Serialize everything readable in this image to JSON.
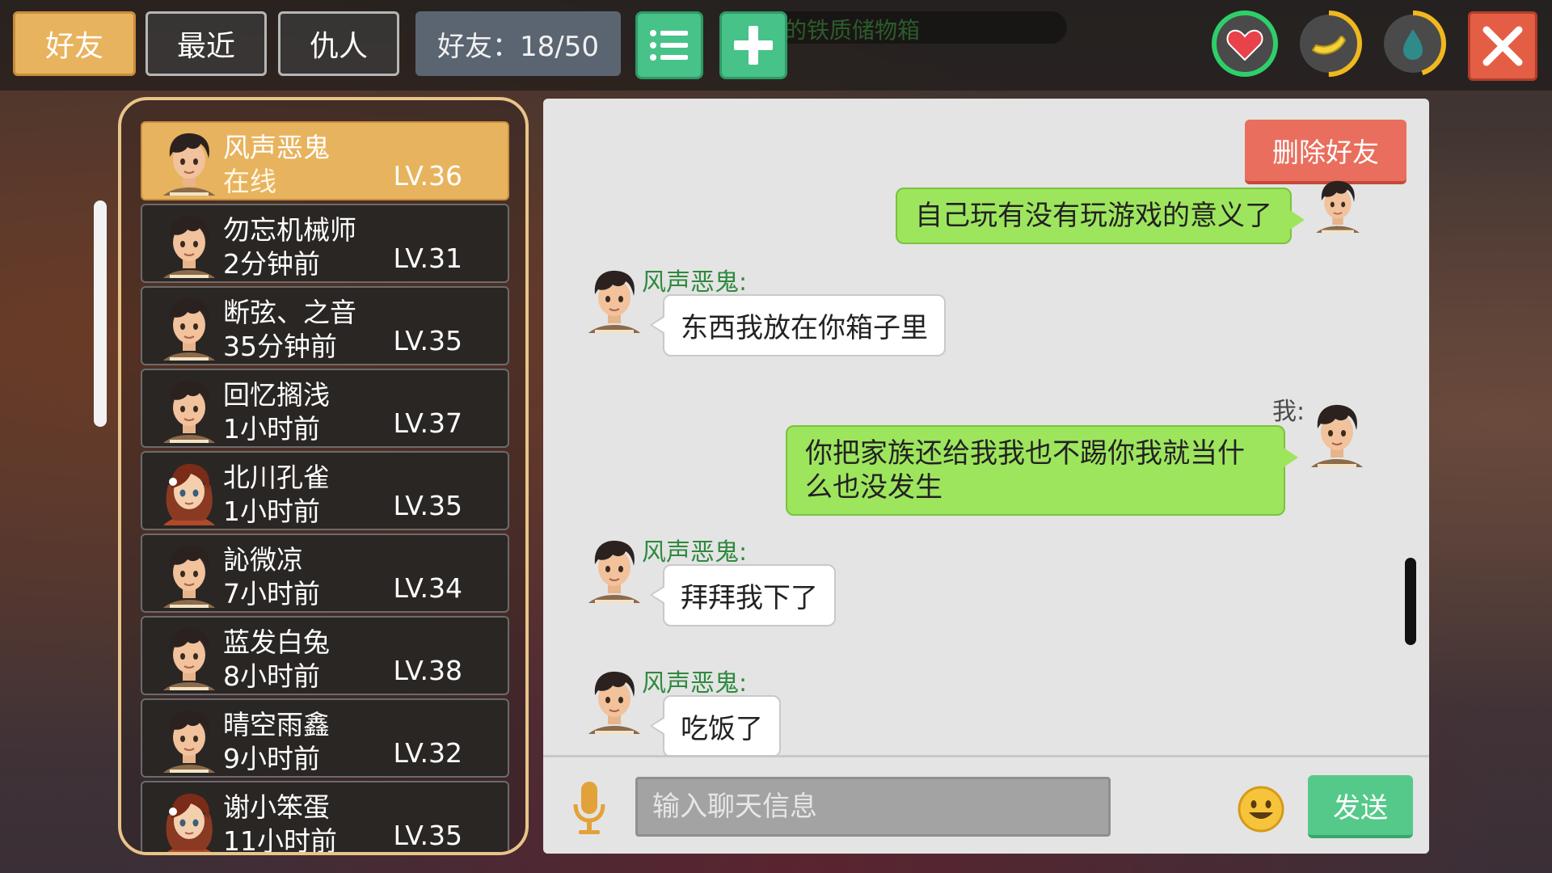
{
  "tabs": [
    {
      "label": "好友",
      "active": true
    },
    {
      "label": "最近",
      "active": false
    },
    {
      "label": "仇人",
      "active": false
    }
  ],
  "friend_count_label": "好友：18/50",
  "banner_text": "的铁质储物箱",
  "icons": {
    "list": "list-icon",
    "add": "plus-icon",
    "health": "heart-icon",
    "hunger": "banana-icon",
    "thirst": "water-drop-icon",
    "close": "close-icon",
    "voice": "microphone-icon",
    "emoji": "smiley-icon"
  },
  "status_levels": {
    "health": 1.0,
    "hunger": 0.5,
    "thirst": 0.45
  },
  "colors": {
    "accent": "#e8b35e",
    "green_button": "#47c288",
    "close_button": "#e45e45",
    "delete_button": "#ea6e5d",
    "my_bubble": "#9ee55e",
    "sender_name": "#2f8a3f"
  },
  "friends": [
    {
      "name": "风声恶鬼",
      "status": "在线",
      "level": "LV.36",
      "avatar": "boy",
      "selected": true
    },
    {
      "name": "勿忘机械师",
      "status": "2分钟前",
      "level": "LV.31",
      "avatar": "boy",
      "selected": false
    },
    {
      "name": "断弦、之音",
      "status": "35分钟前",
      "level": "LV.35",
      "avatar": "boy",
      "selected": false
    },
    {
      "name": "回忆搁浅",
      "status": "1小时前",
      "level": "LV.37",
      "avatar": "boy",
      "selected": false
    },
    {
      "name": "北川孔雀",
      "status": "1小时前",
      "level": "LV.35",
      "avatar": "girl",
      "selected": false
    },
    {
      "name": "訫微凉",
      "status": "7小时前",
      "level": "LV.34",
      "avatar": "boy",
      "selected": false
    },
    {
      "name": "蓝发白兔",
      "status": "8小时前",
      "level": "LV.38",
      "avatar": "boy",
      "selected": false
    },
    {
      "name": "晴空雨鑫",
      "status": "9小时前",
      "level": "LV.32",
      "avatar": "boy",
      "selected": false
    },
    {
      "name": "谢小笨蛋",
      "status": "11小时前",
      "level": "LV.35",
      "avatar": "girl",
      "selected": false
    }
  ],
  "chat": {
    "delete_friend_label": "删除好友",
    "me_label": "我:",
    "sender_label": "风声恶鬼:",
    "messages": [
      {
        "from": "me",
        "text": "自己玩有没有玩游戏的意义了"
      },
      {
        "from": "friend",
        "text": "东西我放在你箱子里"
      },
      {
        "from": "me",
        "text": "你把家族还给我我也不踢你我就当什么也没发生"
      },
      {
        "from": "friend",
        "text": "拜拜我下了"
      },
      {
        "from": "friend",
        "text": "吃饭了"
      }
    ],
    "input_placeholder": "输入聊天信息",
    "send_label": "发送"
  }
}
